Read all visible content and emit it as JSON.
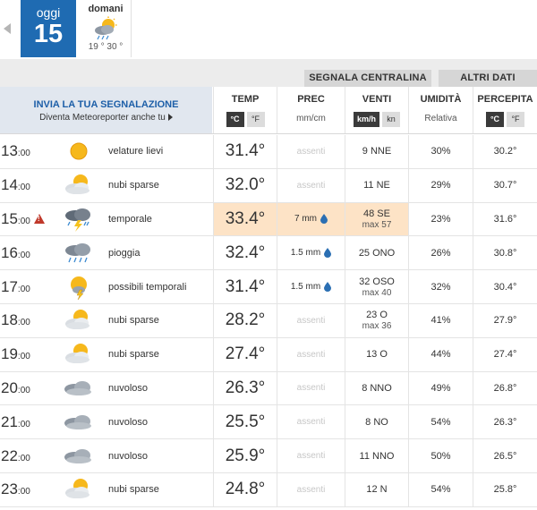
{
  "days": {
    "today": {
      "label": "oggi",
      "number": "15"
    },
    "tomorrow": {
      "label": "domani",
      "icon": "sun-cloud-rain-icon",
      "range": "19 ° 30 °"
    }
  },
  "tabs": {
    "segnala": "SEGNALA CENTRALINA",
    "altri": "ALTRI DATI"
  },
  "invia": {
    "title": "INVIA LA TUA SEGNALAZIONE",
    "subtitle": "Diventa Meteoreporter anche tu"
  },
  "columns": {
    "temp": {
      "label": "TEMP",
      "unit_on": "°C",
      "unit_off": "°F"
    },
    "prec": {
      "label": "PREC",
      "unit": "mm/cm"
    },
    "venti": {
      "label": "VENTI",
      "unit_on": "km/h",
      "unit_off": "kn"
    },
    "umidita": {
      "label": "UMIDITÀ",
      "sub": "Relativa"
    },
    "percepita": {
      "label": "PERCEPITA",
      "unit_on": "°C",
      "unit_off": "°F"
    }
  },
  "rows": [
    {
      "hour": "13",
      "min": ":00",
      "warning": false,
      "icon": "sun",
      "desc": "velature lievi",
      "temp": "31.4°",
      "prec": "assenti",
      "prec_rain": false,
      "wind": "9  NNE",
      "wind_max": "",
      "hum": "30%",
      "perc": "30.2°",
      "highlight": false
    },
    {
      "hour": "14",
      "min": ":00",
      "warning": false,
      "icon": "sun-cloud",
      "desc": "nubi sparse",
      "temp": "32.0°",
      "prec": "assenti",
      "prec_rain": false,
      "wind": "11  NE",
      "wind_max": "",
      "hum": "29%",
      "perc": "30.7°",
      "highlight": false
    },
    {
      "hour": "15",
      "min": ":00",
      "warning": true,
      "icon": "storm",
      "desc": "temporale",
      "temp": "33.4°",
      "prec": "7 mm",
      "prec_rain": true,
      "wind": "48  SE",
      "wind_max": "max 57",
      "hum": "23%",
      "perc": "31.6°",
      "highlight": true
    },
    {
      "hour": "16",
      "min": ":00",
      "warning": false,
      "icon": "rain",
      "desc": "pioggia",
      "temp": "32.4°",
      "prec": "1.5 mm",
      "prec_rain": true,
      "wind": "25  ONO",
      "wind_max": "",
      "hum": "26%",
      "perc": "30.8°",
      "highlight": false
    },
    {
      "hour": "17",
      "min": ":00",
      "warning": false,
      "icon": "sun-storm",
      "desc": "possibili temporali",
      "temp": "31.4°",
      "prec": "1.5 mm",
      "prec_rain": true,
      "wind": "32  OSO",
      "wind_max": "max 40",
      "hum": "32%",
      "perc": "30.4°",
      "highlight": false
    },
    {
      "hour": "18",
      "min": ":00",
      "warning": false,
      "icon": "sun-cloud",
      "desc": "nubi sparse",
      "temp": "28.2°",
      "prec": "assenti",
      "prec_rain": false,
      "wind": "23  O",
      "wind_max": "max 36",
      "hum": "41%",
      "perc": "27.9°",
      "highlight": false
    },
    {
      "hour": "19",
      "min": ":00",
      "warning": false,
      "icon": "sun-cloud",
      "desc": "nubi sparse",
      "temp": "27.4°",
      "prec": "assenti",
      "prec_rain": false,
      "wind": "13  O",
      "wind_max": "",
      "hum": "44%",
      "perc": "27.4°",
      "highlight": false
    },
    {
      "hour": "20",
      "min": ":00",
      "warning": false,
      "icon": "cloudy",
      "desc": "nuvoloso",
      "temp": "26.3°",
      "prec": "assenti",
      "prec_rain": false,
      "wind": "8  NNO",
      "wind_max": "",
      "hum": "49%",
      "perc": "26.8°",
      "highlight": false
    },
    {
      "hour": "21",
      "min": ":00",
      "warning": false,
      "icon": "cloudy",
      "desc": "nuvoloso",
      "temp": "25.5°",
      "prec": "assenti",
      "prec_rain": false,
      "wind": "8  NO",
      "wind_max": "",
      "hum": "54%",
      "perc": "26.3°",
      "highlight": false
    },
    {
      "hour": "22",
      "min": ":00",
      "warning": false,
      "icon": "cloudy",
      "desc": "nuvoloso",
      "temp": "25.9°",
      "prec": "assenti",
      "prec_rain": false,
      "wind": "11  NNO",
      "wind_max": "",
      "hum": "50%",
      "perc": "26.5°",
      "highlight": false
    },
    {
      "hour": "23",
      "min": ":00",
      "warning": false,
      "icon": "sun-cloud",
      "desc": "nubi sparse",
      "temp": "24.8°",
      "prec": "assenti",
      "prec_rain": false,
      "wind": "12  N",
      "wind_max": "",
      "hum": "54%",
      "perc": "25.8°",
      "highlight": false
    }
  ],
  "colors": {
    "accent": "#1f6bb2",
    "highlight": "#fde3c6",
    "warning": "#c0392b",
    "drop": "#2b6fb3"
  }
}
